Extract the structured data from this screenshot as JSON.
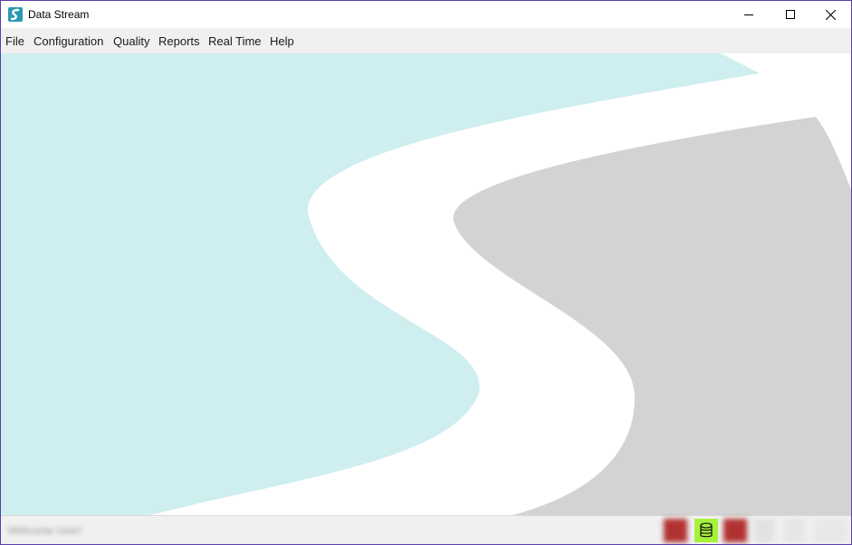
{
  "window": {
    "title": "Data Stream",
    "icon": "app-logo-icon"
  },
  "menu": {
    "items": [
      "File",
      "Configuration",
      "Quality",
      "Reports",
      "Real Time",
      "Help"
    ]
  },
  "canvas": {
    "brand_colors": {
      "teal": "#ceeeef",
      "gray": "#d3d3d3"
    }
  },
  "status": {
    "text": "Welcome User!",
    "database_indicator_color": "#a6f23a",
    "alert_indicator_color": "#b23232"
  }
}
